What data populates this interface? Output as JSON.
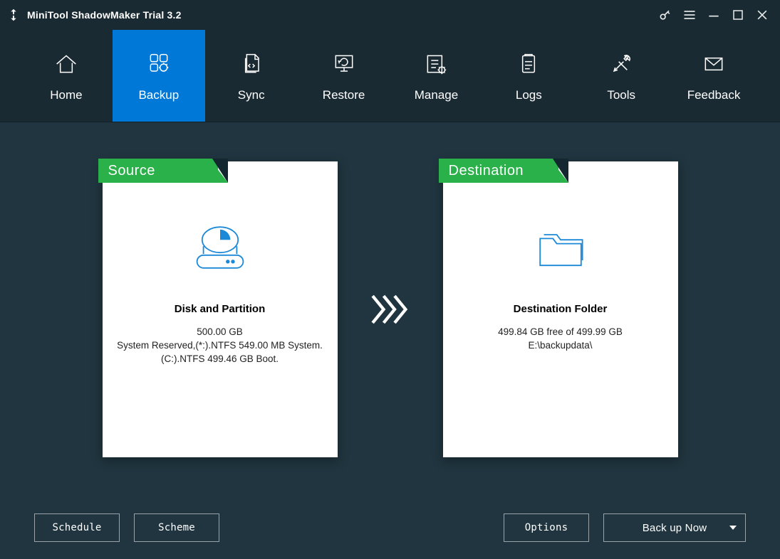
{
  "app": {
    "title": "MiniTool ShadowMaker Trial 3.2"
  },
  "tabs": [
    {
      "label": "Home"
    },
    {
      "label": "Backup"
    },
    {
      "label": "Sync"
    },
    {
      "label": "Restore"
    },
    {
      "label": "Manage"
    },
    {
      "label": "Logs"
    },
    {
      "label": "Tools"
    },
    {
      "label": "Feedback"
    }
  ],
  "source": {
    "banner": "Source",
    "title": "Disk and Partition",
    "size": "500.00 GB",
    "detail1": "System Reserved,(*:).NTFS 549.00 MB System.",
    "detail2": "(C:).NTFS 499.46 GB Boot."
  },
  "destination": {
    "banner": "Destination",
    "title": "Destination Folder",
    "free": "499.84 GB free of 499.99 GB",
    "path": "E:\\backupdata\\"
  },
  "buttons": {
    "schedule": "Schedule",
    "scheme": "Scheme",
    "options": "Options",
    "backupNow": "Back up Now"
  }
}
